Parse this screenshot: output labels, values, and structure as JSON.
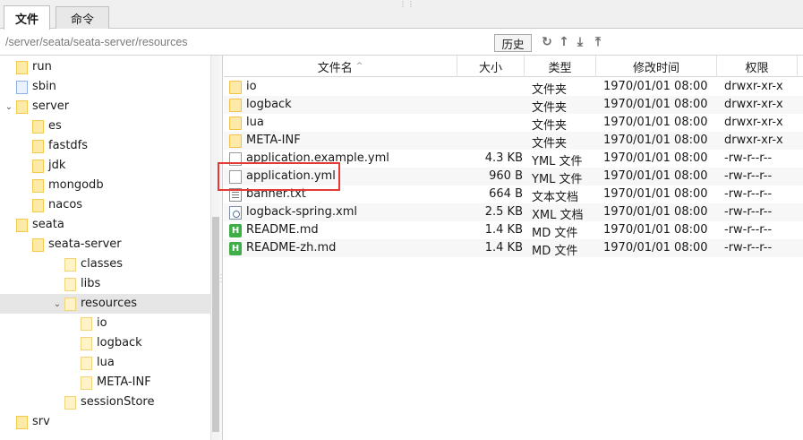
{
  "tabs": [
    {
      "label": "文件",
      "active": true
    },
    {
      "label": "命令",
      "active": false
    }
  ],
  "pathbar": {
    "path": "/server/seata/seata-server/resources",
    "history_label": "历史",
    "tools": [
      "refresh-icon",
      "up-icon",
      "download-icon",
      "upload-icon"
    ]
  },
  "tree": {
    "items": [
      {
        "label": "run",
        "depth": 1,
        "icon": "folder"
      },
      {
        "label": "sbin",
        "depth": 1,
        "icon": "folder-link"
      },
      {
        "label": "server",
        "depth": 0,
        "icon": "folder",
        "expanded": true
      },
      {
        "label": "es",
        "depth": 2,
        "icon": "folder"
      },
      {
        "label": "fastdfs",
        "depth": 2,
        "icon": "folder"
      },
      {
        "label": "jdk",
        "depth": 2,
        "icon": "folder"
      },
      {
        "label": "mongodb",
        "depth": 2,
        "icon": "folder"
      },
      {
        "label": "nacos",
        "depth": 2,
        "icon": "folder"
      },
      {
        "label": "seata",
        "depth": 1,
        "icon": "folder",
        "expanded": true
      },
      {
        "label": "seata-server",
        "depth": 2,
        "icon": "folder",
        "expanded": true
      },
      {
        "label": "classes",
        "depth": 4,
        "icon": "folder"
      },
      {
        "label": "libs",
        "depth": 4,
        "icon": "folder"
      },
      {
        "label": "resources",
        "depth": 3,
        "icon": "folder",
        "expanded": true,
        "selected": true
      },
      {
        "label": "io",
        "depth": 5,
        "icon": "folder"
      },
      {
        "label": "logback",
        "depth": 5,
        "icon": "folder"
      },
      {
        "label": "lua",
        "depth": 5,
        "icon": "folder"
      },
      {
        "label": "META-INF",
        "depth": 5,
        "icon": "folder"
      },
      {
        "label": "sessionStore",
        "depth": 4,
        "icon": "folder"
      },
      {
        "label": "srv",
        "depth": 1,
        "icon": "folder"
      }
    ]
  },
  "list": {
    "headers": {
      "name": "文件名",
      "size": "大小",
      "type": "类型",
      "mtime": "修改时间",
      "perm": "权限"
    },
    "files": [
      {
        "name": "io",
        "size": "",
        "type": "文件夹",
        "mtime": "1970/01/01 08:00",
        "perm": "drwxr-xr-x",
        "icon": "folder"
      },
      {
        "name": "logback",
        "size": "",
        "type": "文件夹",
        "mtime": "1970/01/01 08:00",
        "perm": "drwxr-xr-x",
        "icon": "folder"
      },
      {
        "name": "lua",
        "size": "",
        "type": "文件夹",
        "mtime": "1970/01/01 08:00",
        "perm": "drwxr-xr-x",
        "icon": "folder"
      },
      {
        "name": "META-INF",
        "size": "",
        "type": "文件夹",
        "mtime": "1970/01/01 08:00",
        "perm": "drwxr-xr-x",
        "icon": "folder"
      },
      {
        "name": "application.example.yml",
        "size": "4.3 KB",
        "type": "YML 文件",
        "mtime": "1970/01/01 08:00",
        "perm": "-rw-r--r--",
        "icon": "doc"
      },
      {
        "name": "application.yml",
        "size": "960 B",
        "type": "YML 文件",
        "mtime": "1970/01/01 08:00",
        "perm": "-rw-r--r--",
        "icon": "doc",
        "highlighted": true
      },
      {
        "name": "banner.txt",
        "size": "664 B",
        "type": "文本文档",
        "mtime": "1970/01/01 08:00",
        "perm": "-rw-r--r--",
        "icon": "txt"
      },
      {
        "name": "logback-spring.xml",
        "size": "2.5 KB",
        "type": "XML 文档",
        "mtime": "1970/01/01 08:00",
        "perm": "-rw-r--r--",
        "icon": "xml"
      },
      {
        "name": "README.md",
        "size": "1.4 KB",
        "type": "MD 文件",
        "mtime": "1970/01/01 08:00",
        "perm": "-rw-r--r--",
        "icon": "md"
      },
      {
        "name": "README-zh.md",
        "size": "1.4 KB",
        "type": "MD 文件",
        "mtime": "1970/01/01 08:00",
        "perm": "-rw-r--r--",
        "icon": "md"
      }
    ]
  },
  "colors": {
    "highlight_box": "#e53935",
    "folder": "#fde9a8",
    "md_icon": "#3fae49"
  }
}
